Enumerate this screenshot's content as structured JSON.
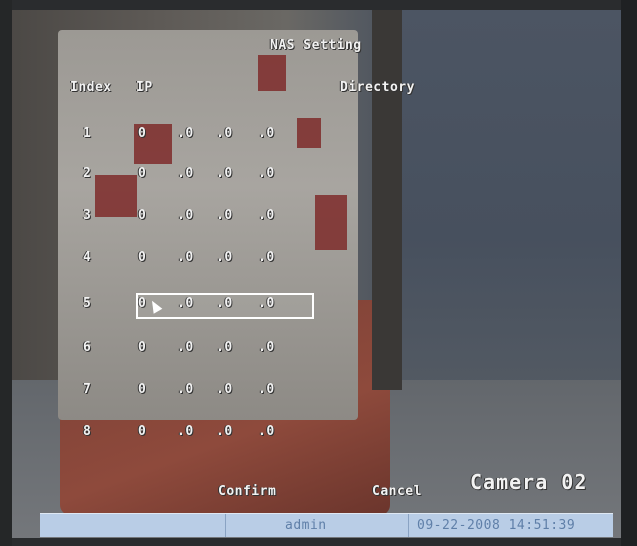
{
  "dialog": {
    "title": "NAS Setting",
    "headers": {
      "index": "Index",
      "ip": "IP",
      "directory": "Directory"
    }
  },
  "rows": [
    {
      "index": "1",
      "ip": [
        "0",
        ".0",
        ".0",
        ".0"
      ]
    },
    {
      "index": "2",
      "ip": [
        "0",
        ".0",
        ".0",
        ".0"
      ]
    },
    {
      "index": "3",
      "ip": [
        "0",
        ".0",
        ".0",
        ".0"
      ]
    },
    {
      "index": "4",
      "ip": [
        "0",
        ".0",
        ".0",
        ".0"
      ]
    },
    {
      "index": "5",
      "ip": [
        "0",
        ".0",
        ".0",
        ".0"
      ],
      "selected": true
    },
    {
      "index": "6",
      "ip": [
        "0",
        ".0",
        ".0",
        ".0"
      ]
    },
    {
      "index": "7",
      "ip": [
        "0",
        ".0",
        ".0",
        ".0"
      ]
    },
    {
      "index": "8",
      "ip": [
        "0",
        ".0",
        ".0",
        ".0"
      ]
    }
  ],
  "buttons": {
    "confirm": "Confirm",
    "cancel": "Cancel"
  },
  "camera_label": "Camera 02",
  "statusbar": {
    "user": "admin",
    "datetime": "09-22-2008 14:51:39"
  },
  "colors": {
    "osd_text": "#f2f2f2",
    "statusbar_bg": "#b9cde6",
    "statusbar_text": "#5f7fa8"
  }
}
